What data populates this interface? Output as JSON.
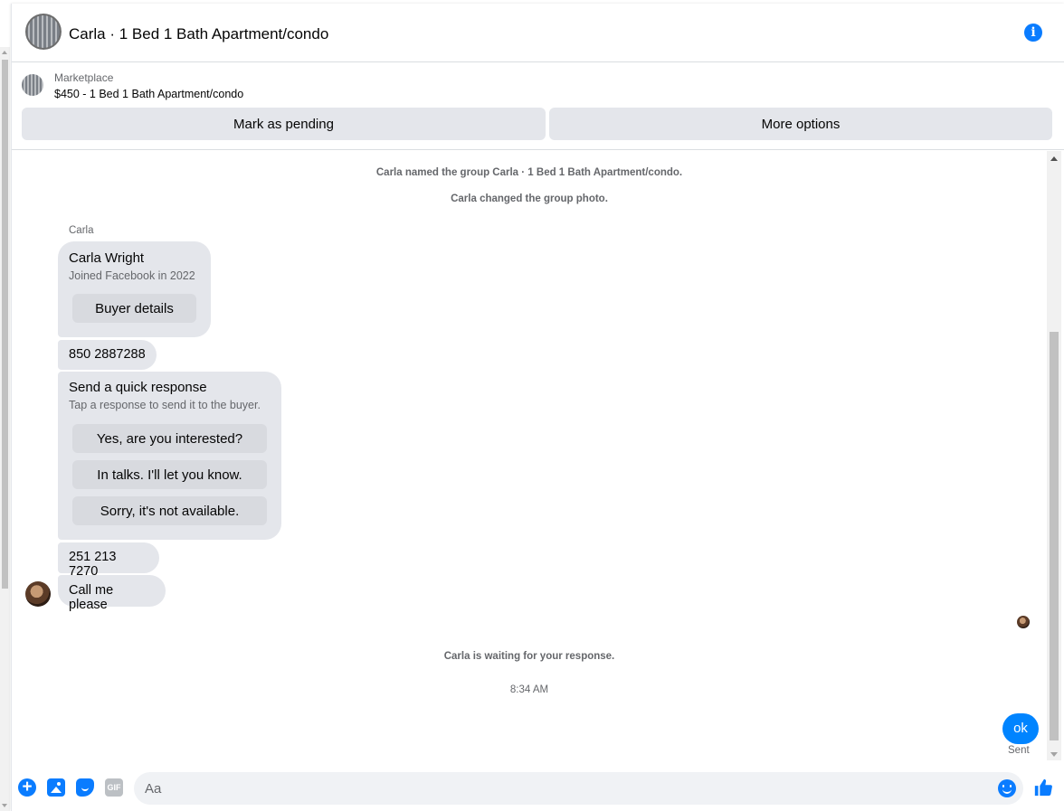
{
  "header": {
    "title": "Carla · 1 Bed 1 Bath Apartment/condo",
    "info_icon": "info-icon"
  },
  "marketplace": {
    "label": "Marketplace",
    "listing": "$450 - 1 Bed 1 Bath Apartment/condo",
    "mark_pending_label": "Mark as pending",
    "more_options_label": "More options"
  },
  "conversation": {
    "system_named": "Carla named the group Carla · 1 Bed 1 Bath Apartment/condo.",
    "system_photo": "Carla changed the group photo.",
    "sender_name": "Carla",
    "profile_card": {
      "name": "Carla Wright",
      "joined": "Joined Facebook in 2022",
      "button_label": "Buyer details"
    },
    "phone_1": "850 2887288",
    "quick_response": {
      "title": "Send a quick response",
      "subtitle": "Tap a response to send it to the buyer.",
      "options": [
        "Yes, are you interested?",
        "In talks. I'll let you know.",
        "Sorry, it's not available."
      ]
    },
    "phone_2": "251 213 7270",
    "last_message": "Call me please",
    "waiting_notice": "Carla is waiting for your response.",
    "timestamp": "8:34 AM",
    "outgoing_message": "ok",
    "delivery_status": "Sent"
  },
  "composer": {
    "placeholder": "Aa",
    "gif_label": "GIF"
  },
  "colors": {
    "accent": "#0a7cff",
    "outgoing_bubble": "#0084ff",
    "incoming_bubble": "#e4e6eb",
    "secondary_text": "#65676b"
  }
}
